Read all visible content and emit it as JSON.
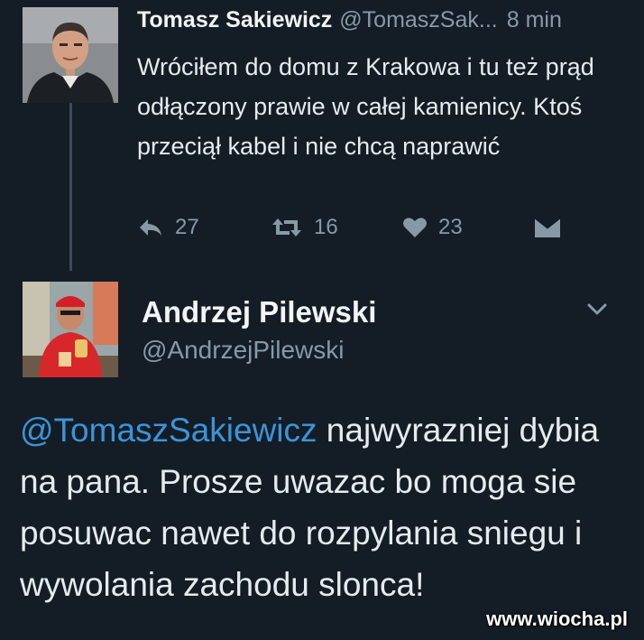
{
  "tweet1": {
    "name": "Tomasz Sakiewicz",
    "handle": "@TomaszSak...",
    "time": "8 min",
    "text": "Wróciłem do domu z Krakowa i tu też prąd odłączony prawie w całej kamienicy. Ktoś przeciął kabel i nie chcą naprawić",
    "reply_count": "27",
    "retweet_count": "16",
    "like_count": "23"
  },
  "tweet2": {
    "name": "Andrzej Pilewski",
    "handle": "@AndrzejPilewski",
    "mention": "@TomaszSakiewicz",
    "text": " najwyrazniej dybia na pana. Prosze uwazac bo moga sie posuwac nawet do rozpylania sniegu i wywolania zachodu slonca!"
  },
  "watermark": "www.wiocha.pl",
  "colors": {
    "background": "#141d26",
    "mention": "#3b94d9",
    "muted": "#8899a6"
  },
  "icons": [
    "reply-icon",
    "retweet-icon",
    "heart-icon",
    "direct-message-icon",
    "chevron-down-icon"
  ]
}
